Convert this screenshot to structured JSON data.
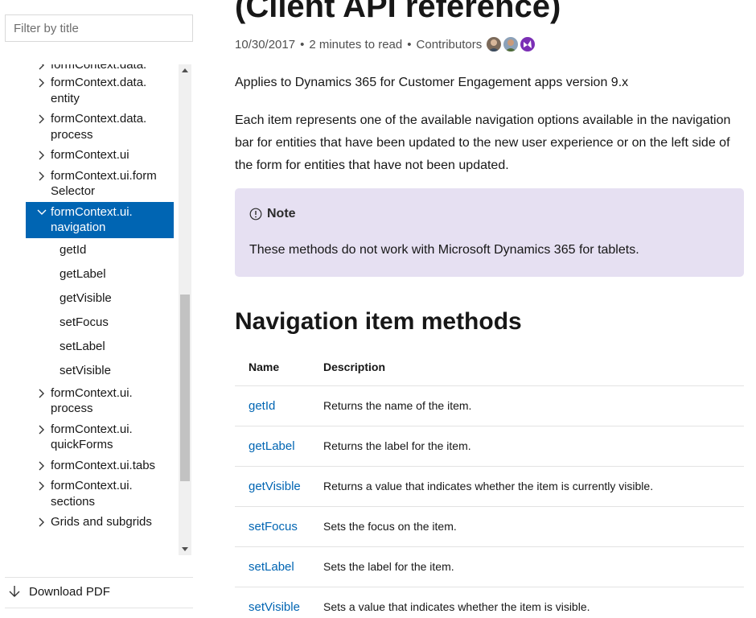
{
  "sidebar": {
    "filter_placeholder": "Filter by title",
    "partial_top_item": "formContext.data.",
    "items": [
      {
        "line1": "formContext.data.",
        "line2": "entity"
      },
      {
        "line1": "formContext.data.",
        "line2": "process"
      },
      {
        "line1": "formContext.ui",
        "line2": ""
      },
      {
        "line1": "formContext.ui.form",
        "line2": "Selector"
      },
      {
        "line1": "formContext.ui.",
        "line2": "navigation"
      }
    ],
    "sub_items": [
      "getId",
      "getLabel",
      "getVisible",
      "setFocus",
      "setLabel",
      "setVisible"
    ],
    "items_after": [
      {
        "line1": "formContext.ui.",
        "line2": "process"
      },
      {
        "line1": "formContext.ui.",
        "line2": "quickForms"
      },
      {
        "line1": "formContext.ui.tabs",
        "line2": ""
      },
      {
        "line1": "formContext.ui.",
        "line2": "sections"
      }
    ],
    "partial_bottom_item": "Grids and subgrids",
    "download_pdf": "Download PDF"
  },
  "main": {
    "title": "(Client API reference)",
    "meta": {
      "date": "10/30/2017",
      "read_time": "2 minutes to read",
      "contributors_label": "Contributors",
      "separator": "•"
    },
    "applies_to": "Applies to Dynamics 365 for Customer Engagement apps version 9.x",
    "description": "Each item represents one of the available navigation options available in the navigation bar for entities that have been updated to the new user experience or on the left side of the form for entities that have not been updated.",
    "note": {
      "label": "Note",
      "text": "These methods do not work with Microsoft Dynamics 365 for tablets."
    },
    "section_heading": "Navigation item methods",
    "table": {
      "headers": [
        "Name",
        "Description"
      ],
      "rows": [
        {
          "name": "getId",
          "description": "Returns the name of the item."
        },
        {
          "name": "getLabel",
          "description": "Returns the label for the item."
        },
        {
          "name": "getVisible",
          "description": "Returns a value that indicates whether the item is currently visible."
        },
        {
          "name": "setFocus",
          "description": "Sets the focus on the item."
        },
        {
          "name": "setLabel",
          "description": "Sets the label for the item."
        },
        {
          "name": "setVisible",
          "description": "Sets a value that indicates whether the item is visible."
        }
      ]
    }
  },
  "colors": {
    "accent": "#0065b3",
    "note_background": "#e6e0f2",
    "text": "#171717",
    "muted_text": "#505050"
  },
  "icons": {
    "collapsed": "chevron-right-icon",
    "expanded": "chevron-down-icon",
    "note": "info-circle-icon",
    "download": "arrow-down-icon"
  }
}
